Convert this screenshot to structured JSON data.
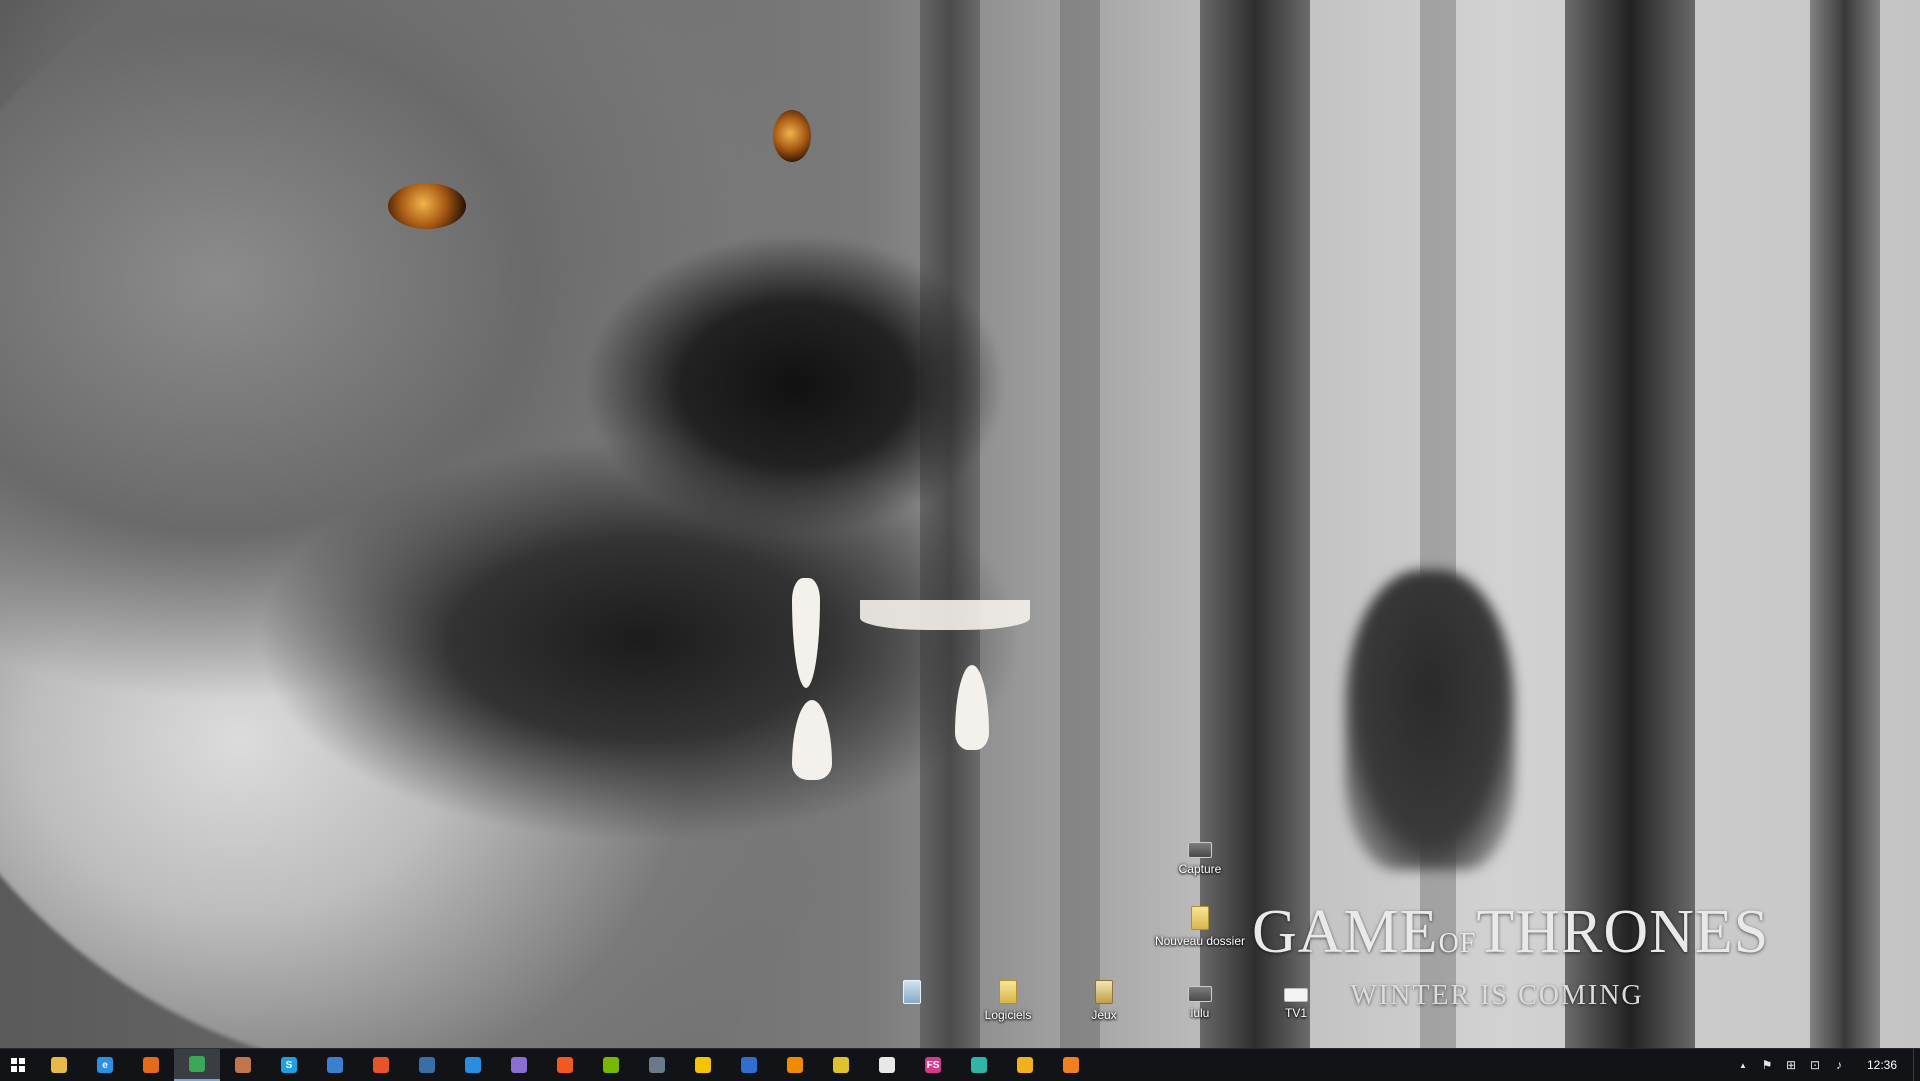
{
  "desktop": {
    "icons": [
      {
        "label": "Capture",
        "icon": "camera-icon"
      },
      {
        "label": "Nouveau dossier",
        "icon": "folder-icon"
      },
      {
        "label": "",
        "icon": "recycle-bin-icon"
      },
      {
        "label": "Logiciels",
        "icon": "folder-icon"
      },
      {
        "label": "Jeux",
        "icon": "game-folder-icon"
      },
      {
        "label": "iulu",
        "icon": "camera-icon"
      },
      {
        "label": "TV1",
        "icon": "white-file-icon"
      }
    ]
  },
  "wallpaper": {
    "logo_title_game": "GAME",
    "logo_title_of": "OF",
    "logo_title_thrones": "THRONES",
    "logo_subtitle": "WINTER IS COMING"
  },
  "taskbar": {
    "apps": [
      {
        "name": "file-explorer-icon",
        "color": "#e8b84a",
        "glyph": ""
      },
      {
        "name": "internet-explorer-icon",
        "color": "#2f8fe0",
        "glyph": "e"
      },
      {
        "name": "firefox-icon",
        "color": "#e46a1c",
        "glyph": ""
      },
      {
        "name": "chrome-icon",
        "color": "#3aa757",
        "glyph": ""
      },
      {
        "name": "paint-icon",
        "color": "#c0754a",
        "glyph": ""
      },
      {
        "name": "skype-icon",
        "color": "#1fa0e3",
        "glyph": "S"
      },
      {
        "name": "app-blue-icon",
        "color": "#3b7fd0",
        "glyph": ""
      },
      {
        "name": "app-orange-icon",
        "color": "#e8542a",
        "glyph": ""
      },
      {
        "name": "steam-icon",
        "color": "#3a6ea5",
        "glyph": ""
      },
      {
        "name": "uplay-icon",
        "color": "#2a8ee0",
        "glyph": ""
      },
      {
        "name": "app-purple-icon",
        "color": "#8b6fd0",
        "glyph": ""
      },
      {
        "name": "origin-icon",
        "color": "#f05a22",
        "glyph": ""
      },
      {
        "name": "nvidia-icon",
        "color": "#76b900",
        "glyph": ""
      },
      {
        "name": "media-icon",
        "color": "#6a7a8a",
        "glyph": ""
      },
      {
        "name": "norton-icon",
        "color": "#f5c400",
        "glyph": ""
      },
      {
        "name": "globe-icon",
        "color": "#2f6fcf",
        "glyph": ""
      },
      {
        "name": "vlc-icon",
        "color": "#f08a00",
        "glyph": ""
      },
      {
        "name": "photos-icon",
        "color": "#e0c030",
        "glyph": ""
      },
      {
        "name": "document-icon",
        "color": "#e8e8e8",
        "glyph": ""
      },
      {
        "name": "fs-icon",
        "color": "#d23a8a",
        "glyph": "FS"
      },
      {
        "name": "app-teal-icon",
        "color": "#2fb5a5",
        "glyph": ""
      },
      {
        "name": "app-yellow-icon",
        "color": "#f0b020",
        "glyph": ""
      },
      {
        "name": "app-orange2-icon",
        "color": "#f08020",
        "glyph": ""
      }
    ],
    "active_app_index": 3,
    "tray": {
      "chevron": "▲",
      "flag": "⚑",
      "windows": "⊞",
      "network": "⊡",
      "volume": "♪"
    },
    "clock": "12:36"
  }
}
